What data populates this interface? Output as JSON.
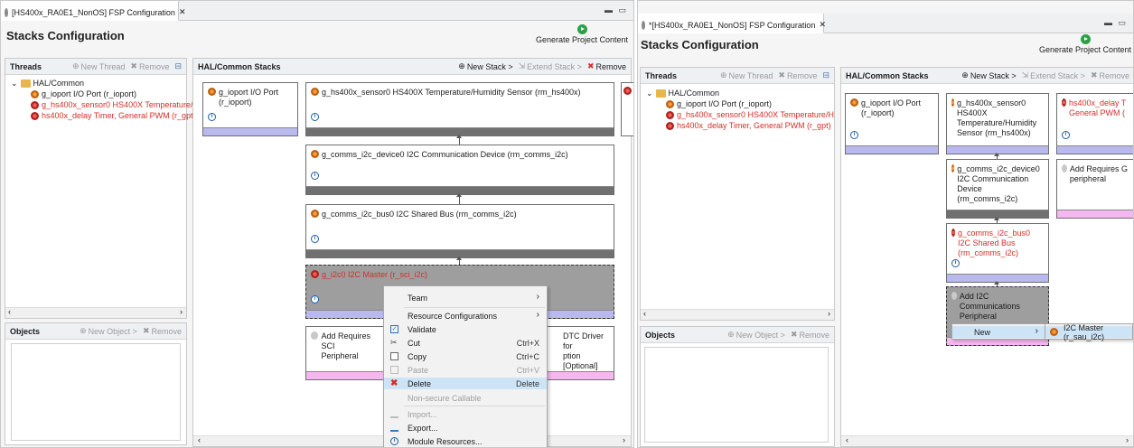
{
  "left": {
    "tab_title": "[HS400x_RA0E1_NonOS] FSP Configuration",
    "page_title": "Stacks Configuration",
    "generate_label": "Generate Project Content",
    "threads": {
      "header": "Threads",
      "new_thread": "New Thread",
      "remove": "Remove",
      "tree": [
        "HAL/Common",
        "g_ioport I/O Port (r_ioport)",
        "g_hs400x_sensor0 HS400X Temperature/H",
        "hs400x_delay Timer, General PWM (r_gpt"
      ]
    },
    "objects": {
      "header": "Objects",
      "new_object": "New Object >",
      "remove": "Remove"
    },
    "stacks": {
      "header": "HAL/Common Stacks",
      "new_stack": "New Stack >",
      "extend_stack": "Extend Stack >",
      "remove": "Remove",
      "mod_ioport_1": "g_ioport I/O Port",
      "mod_ioport_2": "(r_ioport)",
      "mod_sensor": "g_hs400x_sensor0 HS400X Temperature/Humidity Sensor (rm_hs400x)",
      "mod_device": "g_comms_i2c_device0 I2C Communication Device (rm_comms_i2c)",
      "mod_bus": "g_comms_i2c_bus0 I2C Shared Bus (rm_comms_i2c)",
      "mod_master": "g_i2c0 I2C Master (r_sci_i2c)",
      "mod_addsci_1": "Add Requires SCI",
      "mod_addsci_2": "Peripheral",
      "mod_dtc_1": "DTC Driver for",
      "mod_dtc_2": "ption [Optional]"
    },
    "context_menu": [
      {
        "label": "Team",
        "shortcut": ""
      },
      {
        "label": "Resource Configurations",
        "shortcut": ""
      },
      {
        "label": "Validate",
        "shortcut": ""
      },
      {
        "label": "Cut",
        "shortcut": "Ctrl+X"
      },
      {
        "label": "Copy",
        "shortcut": "Ctrl+C"
      },
      {
        "label": "Paste",
        "shortcut": "Ctrl+V"
      },
      {
        "label": "Delete",
        "shortcut": "Delete"
      },
      {
        "label": "Non-secure Callable",
        "shortcut": ""
      },
      {
        "label": "Import...",
        "shortcut": ""
      },
      {
        "label": "Export...",
        "shortcut": ""
      },
      {
        "label": "Module Resources...",
        "shortcut": ""
      }
    ]
  },
  "right": {
    "tab_title": "*[HS400x_RA0E1_NonOS] FSP Configuration",
    "page_title": "Stacks Configuration",
    "generate_label": "Generate Project Content",
    "threads": {
      "header": "Threads",
      "new_thread": "New Thread",
      "remove": "Remove",
      "tree": [
        "HAL/Common",
        "g_ioport I/O Port (r_ioport)",
        "g_hs400x_sensor0 HS400X Temperature/H",
        "hs400x_delay Timer, General PWM (r_gpt)"
      ]
    },
    "objects": {
      "header": "Objects",
      "new_object": "New Object >",
      "remove": "Remove"
    },
    "stacks": {
      "header": "HAL/Common Stacks",
      "new_stack": "New Stack >",
      "extend_stack": "Extend Stack >",
      "remove": "Remove",
      "mod_ioport_1": "g_ioport I/O Port",
      "mod_ioport_2": "(r_ioport)",
      "mod_sensor": "g_hs400x_sensor0 HS400X Temperature/Humidity Sensor (rm_hs400x)",
      "mod_delay": "hs400x_delay T General PWM (",
      "mod_device": "g_comms_i2c_device0 I2C Communication Device (rm_comms_i2c)",
      "mod_addreq": "Add Requires G peripheral",
      "mod_bus": "g_comms_i2c_bus0 I2C Shared Bus (rm_comms_i2c)",
      "mod_addi2c": "Add I2C Communications Peripheral"
    },
    "new_menu": {
      "new_label": "New",
      "submenu_item": "I2C Master (r_sau_i2c)"
    }
  }
}
